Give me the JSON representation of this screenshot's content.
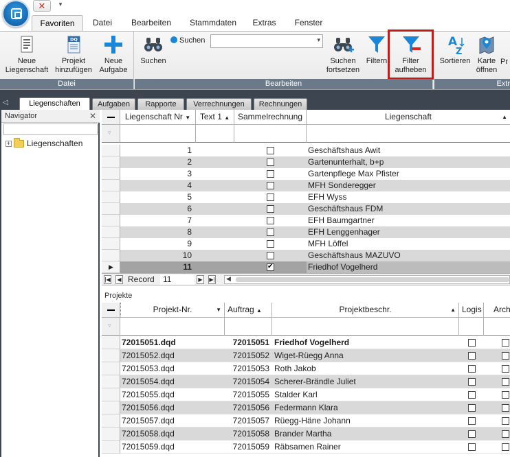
{
  "quick_access": {
    "close_symbol": "✕",
    "dropdown_symbol": "▾"
  },
  "ribbon_tabs": [
    "Favoriten",
    "Datei",
    "Bearbeiten",
    "Stammdaten",
    "Extras",
    "Fenster"
  ],
  "ribbon": {
    "groups": {
      "datei": {
        "label": "Datei",
        "buttons": {
          "neue_liegenschaft": {
            "line1": "Neue",
            "line2": "Liegenschaft",
            "icon": "document-lines-icon"
          },
          "projekt_hinzufuegen": {
            "line1": "Projekt",
            "line2": "hinzufügen",
            "icon": "dq-document-icon",
            "icon_text": "DQ"
          },
          "neue_aufgabe": {
            "line1": "Neue",
            "line2": "Aufgabe",
            "icon": "plus-icon"
          }
        }
      },
      "bearbeiten": {
        "label": "Bearbeiten",
        "buttons": {
          "suchen": {
            "line1": "Suchen",
            "icon": "binoculars-icon"
          },
          "suchen_combo_label": "Suchen",
          "suchen_combo_value": "",
          "suchen_fortsetzen": {
            "line1": "Suchen",
            "line2": "fortsetzen",
            "icon": "binoculars-plus-icon"
          },
          "filtern": {
            "line1": "Filtern",
            "icon": "funnel-icon"
          },
          "filter_aufheben": {
            "line1": "Filter",
            "line2": "aufheben",
            "icon": "funnel-remove-icon"
          }
        }
      },
      "extras": {
        "label": "Extr",
        "buttons": {
          "sortieren": {
            "line1": "Sortieren",
            "icon": "sort-az-icon"
          },
          "karte_oeffnen": {
            "line1": "Karte",
            "line2": "öffnen",
            "icon": "map-icon"
          },
          "more": {
            "line1": "Pr"
          }
        }
      }
    }
  },
  "doc_tabs": [
    "Liegenschaften",
    "Aufgaben",
    "Rapporte",
    "Verrechnungen",
    "Rechnungen"
  ],
  "navigator": {
    "title": "Navigator",
    "close": "✕",
    "tree_root": "Liegenschaften"
  },
  "liegenschaften_grid": {
    "columns": [
      "Liegenschaft Nr",
      "Text 1",
      "Sammelrechnung",
      "Liegenschaft"
    ],
    "rows": [
      {
        "nr": "1",
        "text1": "",
        "sammel": false,
        "name": "Geschäftshaus Awit"
      },
      {
        "nr": "2",
        "text1": "",
        "sammel": false,
        "name": "Gartenunterhalt, b+p"
      },
      {
        "nr": "3",
        "text1": "",
        "sammel": false,
        "name": "Gartenpflege Max Pfister"
      },
      {
        "nr": "4",
        "text1": "",
        "sammel": false,
        "name": "MFH Sonderegger"
      },
      {
        "nr": "5",
        "text1": "",
        "sammel": false,
        "name": "EFH Wyss"
      },
      {
        "nr": "6",
        "text1": "",
        "sammel": false,
        "name": "Geschäftshaus FDM"
      },
      {
        "nr": "7",
        "text1": "",
        "sammel": false,
        "name": "EFH Baumgartner"
      },
      {
        "nr": "8",
        "text1": "",
        "sammel": false,
        "name": "EFH Lenggenhager"
      },
      {
        "nr": "9",
        "text1": "",
        "sammel": false,
        "name": "MFH Löffel"
      },
      {
        "nr": "10",
        "text1": "",
        "sammel": false,
        "name": "Geschäftshaus MAZUVO"
      },
      {
        "nr": "11",
        "text1": "",
        "sammel": true,
        "name": "Friedhof Vogelherd",
        "selected": true
      }
    ],
    "record_nav": {
      "label": "Record",
      "value": "11"
    }
  },
  "projekte_section_label": "Projekte",
  "projekte_grid": {
    "columns": [
      "Projekt-Nr.",
      "Auftrag",
      "Projektbeschr.",
      "Logis",
      "Arch"
    ],
    "rows": [
      {
        "projekt_nr": "72015051.dqd",
        "auftrag": "72015051",
        "beschr": "Friedhof Vogelherd",
        "bold": true
      },
      {
        "projekt_nr": "72015052.dqd",
        "auftrag": "72015052",
        "beschr": "Wiget-Rüegg Anna"
      },
      {
        "projekt_nr": "72015053.dqd",
        "auftrag": "72015053",
        "beschr": "Roth Jakob"
      },
      {
        "projekt_nr": "72015054.dqd",
        "auftrag": "72015054",
        "beschr": "Scherer-Brändle Juliet"
      },
      {
        "projekt_nr": "72015055.dqd",
        "auftrag": "72015055",
        "beschr": "Stalder Karl"
      },
      {
        "projekt_nr": "72015056.dqd",
        "auftrag": "72015056",
        "beschr": "Federmann Klara"
      },
      {
        "projekt_nr": "72015057.dqd",
        "auftrag": "72015057",
        "beschr": "Rüegg-Häne Johann"
      },
      {
        "projekt_nr": "72015058.dqd",
        "auftrag": "72015058",
        "beschr": "Brander Martha"
      },
      {
        "projekt_nr": "72015059.dqd",
        "auftrag": "72015059",
        "beschr": "Räbsamen Rainer"
      }
    ]
  },
  "colors": {
    "accent_blue": "#1a86d8",
    "highlight_box": "#c01b1b",
    "dark_band": "#3c4550",
    "row_alt": "#d9d9d9",
    "row_selected": "#a3a3a3"
  }
}
